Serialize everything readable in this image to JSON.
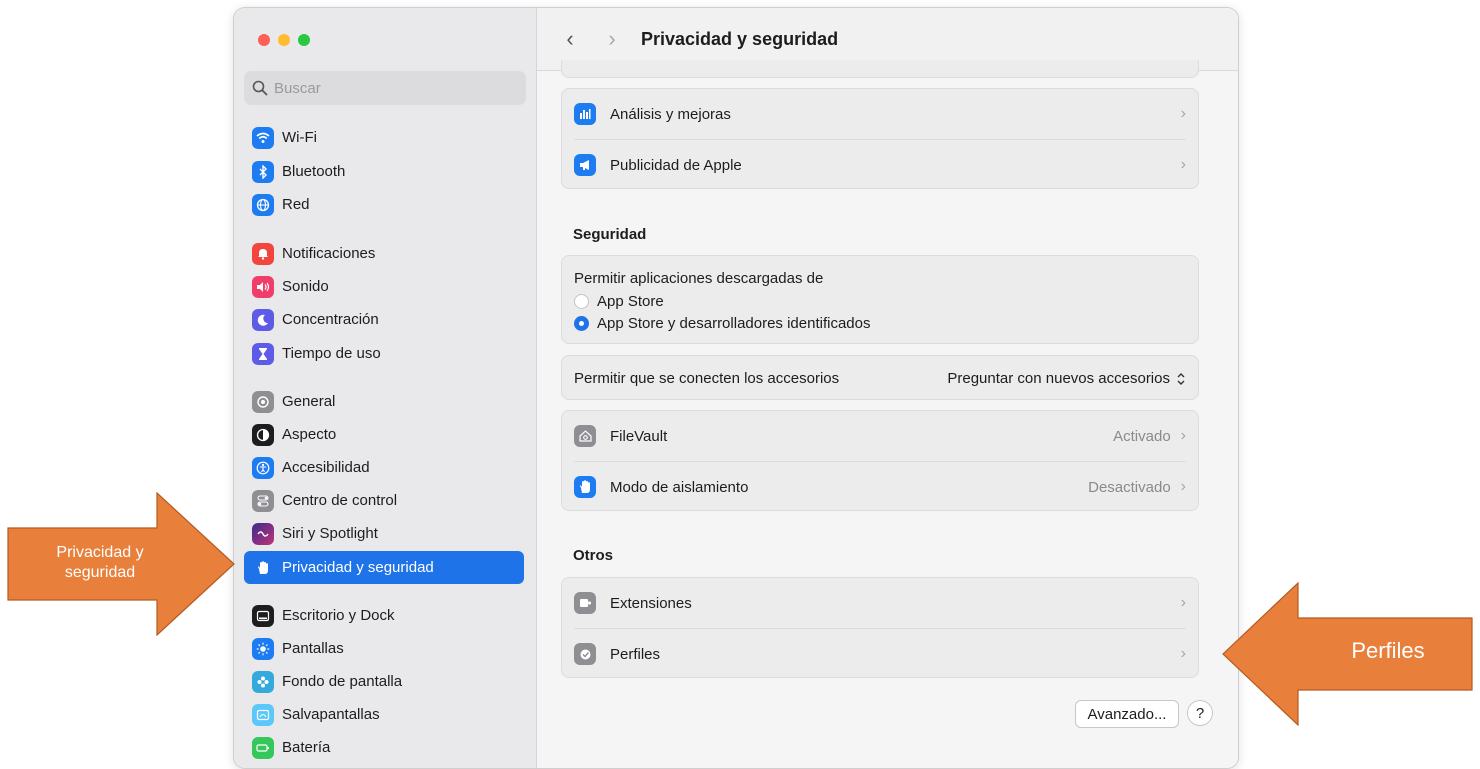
{
  "window": {
    "traffic_colors": [
      "#fe5f57",
      "#febc2e",
      "#28c840"
    ]
  },
  "sidebar": {
    "search_placeholder": "Buscar",
    "items": [
      {
        "label": "Wi-Fi",
        "icon": "wifi-icon",
        "color": "#1e7cf2"
      },
      {
        "label": "Bluetooth",
        "icon": "bluetooth-icon",
        "color": "#1e7cf2"
      },
      {
        "label": "Red",
        "icon": "globe-icon",
        "color": "#1e7cf2"
      },
      {
        "label": "Notificaciones",
        "icon": "bell-icon",
        "color": "#f2453d"
      },
      {
        "label": "Sonido",
        "icon": "speaker-icon",
        "color": "#f03d6a"
      },
      {
        "label": "Concentración",
        "icon": "moon-icon",
        "color": "#5e5ce6"
      },
      {
        "label": "Tiempo de uso",
        "icon": "hourglass-icon",
        "color": "#5e5ce6"
      },
      {
        "label": "General",
        "icon": "gear-icon",
        "color": "#8e8e93"
      },
      {
        "label": "Aspecto",
        "icon": "appearance-icon",
        "color": "#1d1d1f"
      },
      {
        "label": "Accesibilidad",
        "icon": "accessibility-icon",
        "color": "#1e7cf2"
      },
      {
        "label": "Centro de control",
        "icon": "toggles-icon",
        "color": "#8e8e93"
      },
      {
        "label": "Siri y Spotlight",
        "icon": "siri-icon",
        "color": "#6b4fd0"
      },
      {
        "label": "Privacidad y seguridad",
        "icon": "hand-icon",
        "color": "#1e73e8"
      },
      {
        "label": "Escritorio y Dock",
        "icon": "dock-icon",
        "color": "#1d1d1f"
      },
      {
        "label": "Pantallas",
        "icon": "sun-icon",
        "color": "#1e7cf2"
      },
      {
        "label": "Fondo de pantalla",
        "icon": "flower-icon",
        "color": "#34aadc"
      },
      {
        "label": "Salvapantallas",
        "icon": "screensaver-icon",
        "color": "#5ac8fa"
      },
      {
        "label": "Batería",
        "icon": "battery-icon",
        "color": "#34c759"
      }
    ],
    "selected_index": 12
  },
  "toolbar": {
    "back": "‹",
    "forward": "›",
    "title": "Privacidad y seguridad"
  },
  "privacy": {
    "rows": [
      {
        "label": "Análisis y mejoras",
        "icon": "chart-icon",
        "color": "#1e7cf2"
      },
      {
        "label": "Publicidad de Apple",
        "icon": "megaphone-icon",
        "color": "#1e7cf2"
      }
    ]
  },
  "security": {
    "title": "Seguridad",
    "allow_apps_label": "Permitir aplicaciones descargadas de",
    "options": [
      "App Store",
      "App Store y desarrolladores identificados"
    ],
    "selected_option": 1,
    "accessories_label": "Permitir que se conecten los accesorios",
    "accessories_value": "Preguntar con nuevos accesorios",
    "rows": [
      {
        "label": "FileVault",
        "value": "Activado",
        "icon": "house-lock-icon",
        "color": "#8e8e93"
      },
      {
        "label": "Modo de aislamiento",
        "value": "Desactivado",
        "icon": "hand-icon",
        "color": "#1e7cf2"
      }
    ]
  },
  "others": {
    "title": "Otros",
    "rows": [
      {
        "label": "Extensiones",
        "icon": "puzzle-icon",
        "color": "#8e8e93"
      },
      {
        "label": "Perfiles",
        "icon": "checkmark-badge-icon",
        "color": "#8e8e93"
      }
    ]
  },
  "footer": {
    "advanced_label": "Avanzado...",
    "help_label": "?"
  },
  "callouts": {
    "left": "Privacidad y seguridad",
    "right": "Perfiles",
    "color": "#e8803b"
  }
}
